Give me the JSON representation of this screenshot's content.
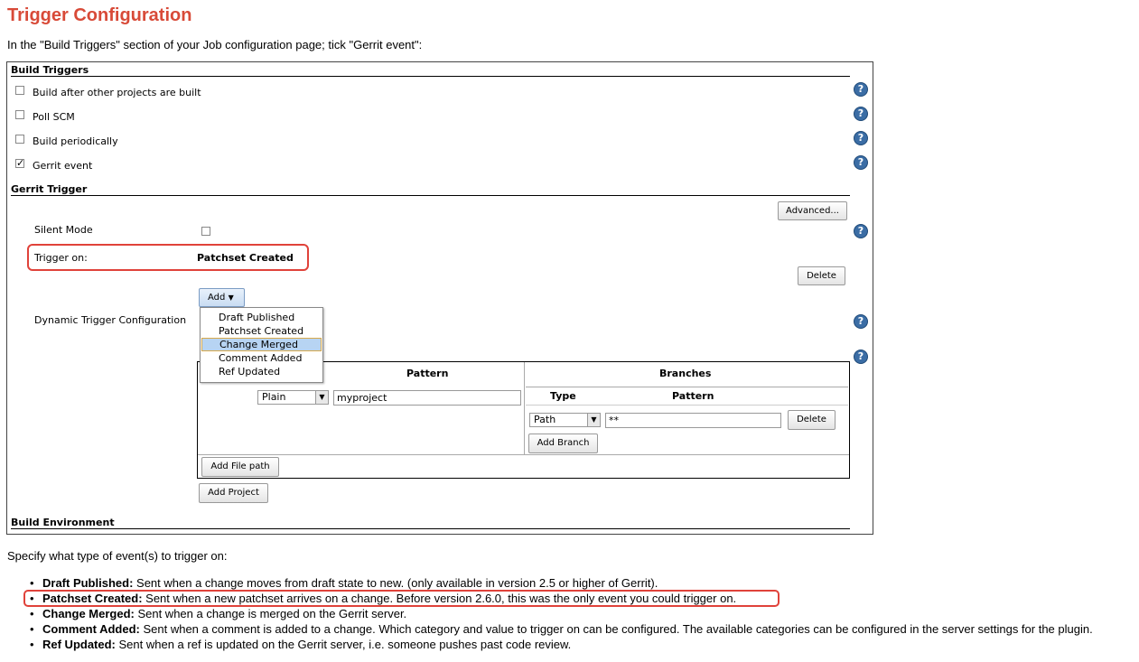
{
  "title": "Trigger Configuration",
  "intro": "In the \"Build Triggers\" section of your Job configuration page; tick \"Gerrit event\":",
  "build_triggers": {
    "heading": "Build Triggers",
    "items": [
      {
        "label": "Build after other projects are built",
        "checked": false
      },
      {
        "label": "Poll SCM",
        "checked": false
      },
      {
        "label": "Build periodically",
        "checked": false
      },
      {
        "label": "Gerrit event",
        "checked": true
      }
    ]
  },
  "gerrit_trigger": {
    "heading": "Gerrit Trigger",
    "advanced_label": "Advanced...",
    "silent_mode_label": "Silent Mode",
    "trigger_on_label": "Trigger on:",
    "trigger_on_value": "Patchset Created",
    "delete_label": "Delete",
    "add_label": "Add",
    "dynamic_label": "Dynamic Trigger Configuration",
    "dropdown_items": [
      "Draft Published",
      "Patchset Created",
      "Change Merged",
      "Comment Added",
      "Ref Updated"
    ],
    "dropdown_selected": "Change Merged"
  },
  "project_table": {
    "col_pattern": "Pattern",
    "col_branches": "Branches",
    "project_type": "Plain",
    "project_pattern": "myproject",
    "branch_col_type": "Type",
    "branch_col_pattern": "Pattern",
    "branch_type": "Path",
    "branch_pattern": "**",
    "branch_delete": "Delete",
    "add_branch": "Add Branch",
    "add_file_path": "Add File path",
    "add_project": "Add Project"
  },
  "build_environment_heading": "Build Environment",
  "events_intro": "Specify what type of event(s) to trigger on:",
  "events": [
    {
      "name": "Draft Published:",
      "desc": " Sent when a change moves from draft state to new. (only available in version 2.5 or higher of Gerrit)."
    },
    {
      "name": "Patchset Created:",
      "desc": " Sent when a new patchset arrives on a change. Before version 2.6.0, this was the only event you could trigger on."
    },
    {
      "name": "Change Merged:",
      "desc": " Sent when a change is merged on the Gerrit server."
    },
    {
      "name": "Comment Added:",
      "desc": " Sent when a comment is added to a change. Which category and value to trigger on can be configured. The available categories can be configured in the server settings for the plugin."
    },
    {
      "name": "Ref Updated:",
      "desc": " Sent when a ref is updated on the Gerrit server, i.e. someone pushes past code review."
    }
  ],
  "colors": {
    "title": "#d84a38",
    "highlight": "#e0423a",
    "help_icon": "#3b6da5",
    "dropdown_selected": "#b7d4f3"
  }
}
